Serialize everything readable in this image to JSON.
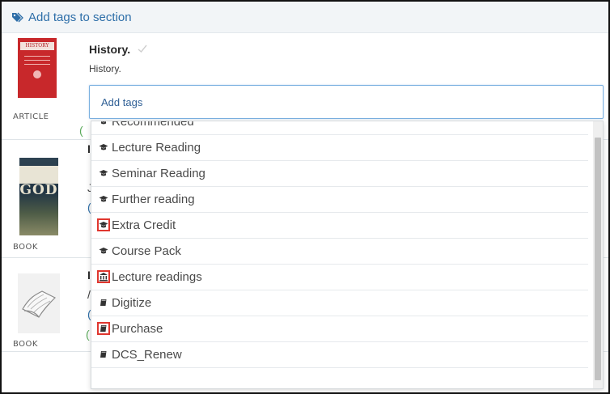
{
  "header": {
    "add_tags_link": "Add tags to section"
  },
  "items": [
    {
      "type": "ARTICLE",
      "title": "History.",
      "subtitle": "History.",
      "cover_text": "HISTORY"
    },
    {
      "type": "BOOK",
      "cover_text": "GOD"
    },
    {
      "type": "BOOK"
    }
  ],
  "search": {
    "placeholder": "Add tags"
  },
  "dropdown": {
    "options": [
      {
        "label": "Recommended",
        "icon": "graduation-cap-icon"
      },
      {
        "label": "Lecture Reading",
        "icon": "graduation-cap-icon"
      },
      {
        "label": "Seminar Reading",
        "icon": "graduation-cap-icon"
      },
      {
        "label": "Further reading",
        "icon": "graduation-cap-icon"
      },
      {
        "label": "Extra Credit",
        "icon": "graduation-cap-icon"
      },
      {
        "label": "Course Pack",
        "icon": "graduation-cap-icon"
      },
      {
        "label": "Lecture readings",
        "icon": "institution-icon"
      },
      {
        "label": "Digitize",
        "icon": "book-icon"
      },
      {
        "label": "Purchase",
        "icon": "book-icon"
      },
      {
        "label": "DCS_Renew",
        "icon": "book-icon"
      }
    ]
  },
  "colors": {
    "link": "#2d6ea8",
    "highlight_box": "#e0372f",
    "article_cover": "#c8282b"
  }
}
